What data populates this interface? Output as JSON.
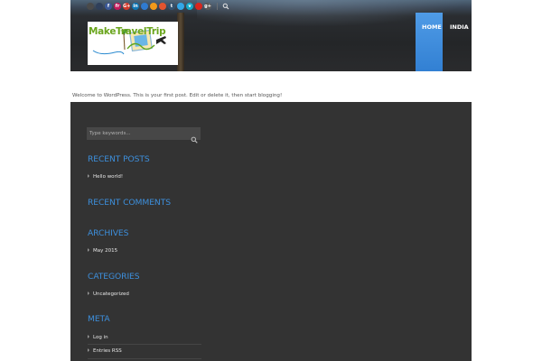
{
  "header": {
    "social_icons": [
      {
        "name": "delicious-icon",
        "glyph": "",
        "color": "#4a4a4a"
      },
      {
        "name": "email-icon",
        "glyph": "",
        "color": "#2f3f5a"
      },
      {
        "name": "facebook-icon",
        "glyph": "f",
        "color": "#3b5998"
      },
      {
        "name": "flickr-icon",
        "glyph": "fr",
        "color": "#c2185b"
      },
      {
        "name": "google-plus-icon",
        "glyph": "G+",
        "color": "#d33a2c"
      },
      {
        "name": "linkedin-icon",
        "glyph": "in",
        "color": "#0f77b5"
      },
      {
        "name": "pinterest-icon",
        "glyph": "",
        "color": "#2f7bd1"
      },
      {
        "name": "rss-icon",
        "glyph": "",
        "color": "#f29a1a"
      },
      {
        "name": "stumbleupon-icon",
        "glyph": "",
        "color": "#e3542e"
      },
      {
        "name": "tumblr-icon",
        "glyph": "t",
        "color": "#34526f"
      },
      {
        "name": "twitter-icon",
        "glyph": "",
        "color": "#33a7e8"
      },
      {
        "name": "vimeo-icon",
        "glyph": "v",
        "color": "#16a9c8"
      },
      {
        "name": "youtube-icon",
        "glyph": "",
        "color": "#d9251d"
      },
      {
        "name": "google-plus-alt-icon",
        "glyph": "g+",
        "color": "#5a5a5a"
      }
    ],
    "logo_text": "MakeTravelTrip",
    "nav": [
      {
        "label": "HOME",
        "active": true
      },
      {
        "label": "INDIA",
        "active": false
      }
    ]
  },
  "post": {
    "welcome_text": "Welcome to WordPress. This is your first post. Edit or delete it, then start blogging!"
  },
  "sidebar": {
    "search_placeholder": "Type keywords...",
    "recent_posts": {
      "title": "RECENT POSTS",
      "items": [
        "Hello world!"
      ]
    },
    "recent_comments": {
      "title": "RECENT COMMENTS"
    },
    "archives": {
      "title": "ARCHIVES",
      "items": [
        "May 2015"
      ]
    },
    "categories": {
      "title": "CATEGORIES",
      "items": [
        "Uncategorized"
      ]
    },
    "meta": {
      "title": "META",
      "items": [
        "Log in",
        "Entries RSS"
      ]
    }
  },
  "colors": {
    "accent": "#3d8fdc",
    "panel": "#333333",
    "nav_active": "#3a86d6"
  }
}
